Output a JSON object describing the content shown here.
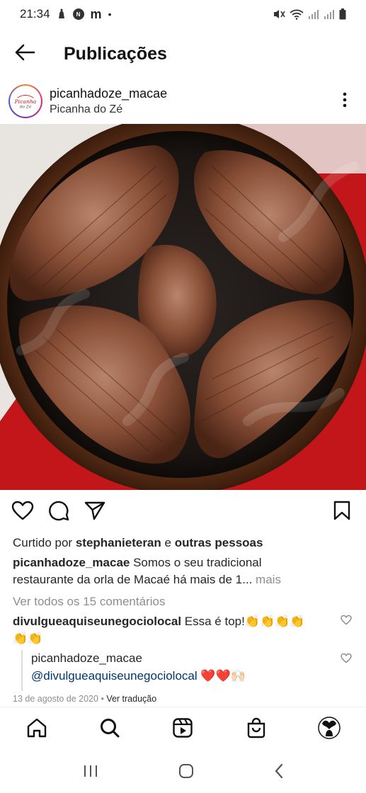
{
  "status": {
    "time": "21:34"
  },
  "header": {
    "title": "Publicações"
  },
  "post": {
    "username": "picanhadoze_macae",
    "location": "Picanha do Zé",
    "avatar_text": "Picanha do Zé",
    "likes_prefix": "Curtido por",
    "likes_user": "stephanieteran",
    "likes_and": "e",
    "likes_others": "outras pessoas",
    "caption_user": "picanhadoze_macae",
    "caption_line1": "Somos o seu tradicional",
    "caption_line2": "restaurante da orla de Macaé há mais de 1...",
    "caption_more": "mais",
    "view_comments": "Ver todos os 15 comentários",
    "comment_user": "divulgueaquiseunegociolocal",
    "comment_text": "Essa é top!👏👏👏👏",
    "comment_line2": "👏👏",
    "reply_user": "picanhadoze_macae",
    "reply_mention": "@divulgueaquiseunegociolocal",
    "reply_emoji": "❤️❤️🙌🏻",
    "date": "13 de agosto de 2020",
    "translate": "Ver tradução",
    "meta_sep": "•"
  },
  "colors": {
    "accent_red": "#c2161b",
    "muted": "#8e8e8e",
    "mention": "#00376b"
  },
  "icons": {
    "back": "arrow-left-icon",
    "more": "more-vertical-icon",
    "like": "heart-icon",
    "comment": "comment-icon",
    "share": "send-icon",
    "save": "bookmark-icon",
    "home": "home-icon",
    "search": "search-icon",
    "reels": "reels-icon",
    "shop": "shop-icon",
    "profile": "profile-avatar"
  }
}
